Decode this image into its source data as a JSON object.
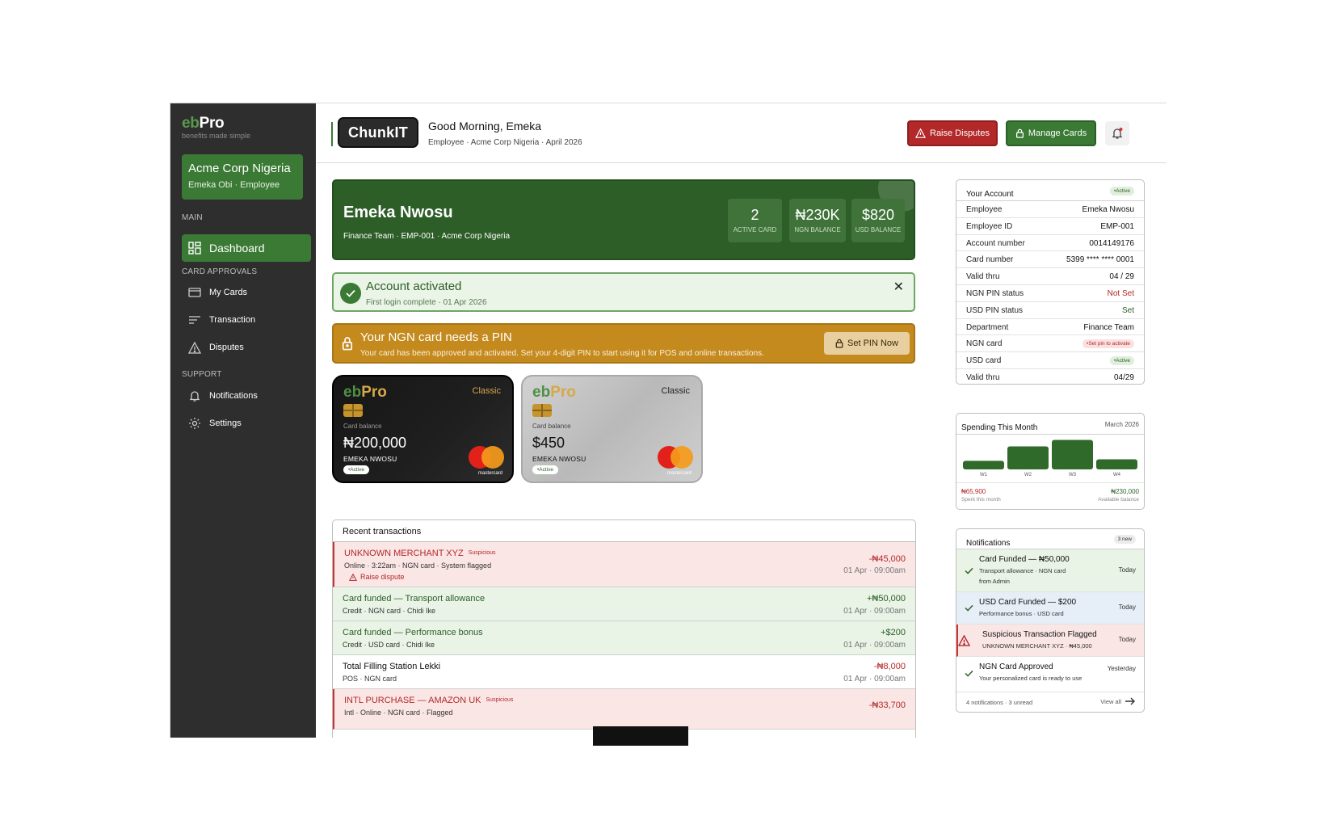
{
  "sidebar": {
    "brand": {
      "eb": "eb",
      "pro": "Pro",
      "tagline": "benefits made simple"
    },
    "org": {
      "name": "Acme Corp Nigeria",
      "user": "Emeka Obi · Employee"
    },
    "sections": {
      "main": "MAIN",
      "card_approvals": "CARD APPROVALS",
      "support": "SUPPORT"
    },
    "items": [
      {
        "label": "Dashboard",
        "icon": "grid-icon",
        "active": true
      },
      {
        "label": "My Cards",
        "icon": "card-icon"
      },
      {
        "label": "Transaction",
        "icon": "list-icon"
      },
      {
        "label": "Disputes",
        "icon": "warning-icon"
      },
      {
        "label": "Notifications",
        "icon": "bell-icon"
      },
      {
        "label": "Settings",
        "icon": "gear-icon"
      }
    ]
  },
  "header": {
    "logo": "ChunkIT",
    "greeting": "Good Morning, Emeka",
    "subtitle": "Employee · Acme Corp Nigeria · April 2026",
    "raise_disputes": "Raise Disputes",
    "manage_cards": "Manage Cards"
  },
  "hero": {
    "name": "Emeka Nwosu",
    "sub": "Finance Team · EMP-001 · Acme Corp Nigeria",
    "stats": [
      {
        "value": "2",
        "label": "ACTIVE CARD"
      },
      {
        "value": "₦230K",
        "label": "NGN BALANCE"
      },
      {
        "value": "$820",
        "label": "USD BALANCE"
      }
    ]
  },
  "activated": {
    "title": "Account activated",
    "sub": "First login complete · 01 Apr 2026",
    "close": "✕"
  },
  "pin_banner": {
    "title": "Your NGN card needs a PIN",
    "sub": "Your card has been approved and activated. Set your 4-digit PIN to start using it for POS and online transactions.",
    "button": "Set PIN Now"
  },
  "cards": [
    {
      "logo_eb": "eb",
      "logo_pro": "Pro",
      "class": "Classic",
      "balance_label": "Card balance",
      "balance": "₦200,000",
      "holder": "EMEKA NWOSU",
      "status": "Active",
      "network": "mastercard"
    },
    {
      "logo_eb": "eb",
      "logo_pro": "Pro",
      "class": "Classic",
      "balance_label": "Card balance",
      "balance": "$450",
      "holder": "EMEKA NWOSU",
      "status": "Active",
      "network": "mastercard"
    }
  ],
  "transactions": {
    "title": "Recent transactions",
    "rows": [
      {
        "name": "UNKNOWN MERCHANT XYZ",
        "tag": "Suspicious",
        "meta": "Online · 3:22am · NGN card · System flagged",
        "action": "Raise dispute",
        "amount": "-₦45,000",
        "date": "01 Apr · 09:00am",
        "kind": "red"
      },
      {
        "name": "Card funded — Transport allowance",
        "meta": "Credit · NGN card · Chidi Ike",
        "amount": "+₦50,000",
        "date": "01 Apr · 09:00am",
        "kind": "green"
      },
      {
        "name": "Card funded — Performance bonus",
        "meta": "Credit · USD card · Chidi Ike",
        "amount": "+$200",
        "date": "01 Apr · 09:00am",
        "kind": "green"
      },
      {
        "name": "Total Filling Station Lekki",
        "meta": "POS · NGN card",
        "amount": "-₦8,000",
        "date": "01 Apr · 09:00am",
        "kind": "white"
      },
      {
        "name": "INTL PURCHASE — AMAZON UK",
        "tag": "Suspicious",
        "meta": "Intl · Online · NGN card · Flagged",
        "amount": "-₦33,700",
        "date": "",
        "kind": "red"
      }
    ]
  },
  "account": {
    "title": "Your Account",
    "status": "Active",
    "rows": [
      {
        "k": "Employee",
        "v": "Emeka Nwosu"
      },
      {
        "k": "Employee ID",
        "v": "EMP-001"
      },
      {
        "k": "Account number",
        "v": "0014149176"
      },
      {
        "k": "Card number",
        "v": "5399 **** **** 0001"
      },
      {
        "k": "Valid thru",
        "v": "04 / 29"
      },
      {
        "k": "NGN PIN status",
        "v": "Not Set"
      },
      {
        "k": "USD PIN status",
        "v": "Set"
      },
      {
        "k": "Department",
        "v": "Finance Team"
      },
      {
        "k": "NGN card",
        "v": "Set pin to activate"
      },
      {
        "k": "USD card",
        "v": "Active"
      },
      {
        "k": "Valid thru",
        "v": "04/29"
      }
    ]
  },
  "spending": {
    "title": "Spending This Month",
    "month": "March 2026",
    "spent": "₦65,900",
    "spent_label": "Spent this month",
    "available": "₦230,000",
    "available_label": "Available balance"
  },
  "chart_data": {
    "type": "bar",
    "categories": [
      "W1",
      "W2",
      "W3",
      "W4"
    ],
    "values": [
      12,
      32,
      41,
      14
    ],
    "ylim": [
      0,
      45
    ],
    "grid": false,
    "colors": {
      "bar": "#2f6a2a"
    }
  },
  "notifications": {
    "title": "Notifications",
    "badge": "3 new",
    "items": [
      {
        "title": "Card Funded — ₦50,000",
        "sub1": "Transport allowance · NGN card",
        "sub2": "from Admin",
        "when": "Today",
        "kind": "green"
      },
      {
        "title": "USD Card Funded — $200",
        "sub1": "Performance bonus · USD card",
        "when": "Today",
        "kind": "blue"
      },
      {
        "title": "Suspicious Transaction Flagged",
        "sub1": "UNKNOWN MERCHANT XYZ · ₦45,000",
        "when": "Today",
        "kind": "red"
      },
      {
        "title": "NGN Card Approved",
        "sub1": "Your personalized card is ready to use",
        "when": "Yesterday",
        "kind": "white"
      }
    ],
    "footer": "4 notifications · 3 unread",
    "view_all": "View all"
  },
  "colors": {
    "brand_green": "#3a7a34",
    "danger": "#b32828",
    "warning": "#c48a1e",
    "sidebar": "#2e2e2e"
  }
}
